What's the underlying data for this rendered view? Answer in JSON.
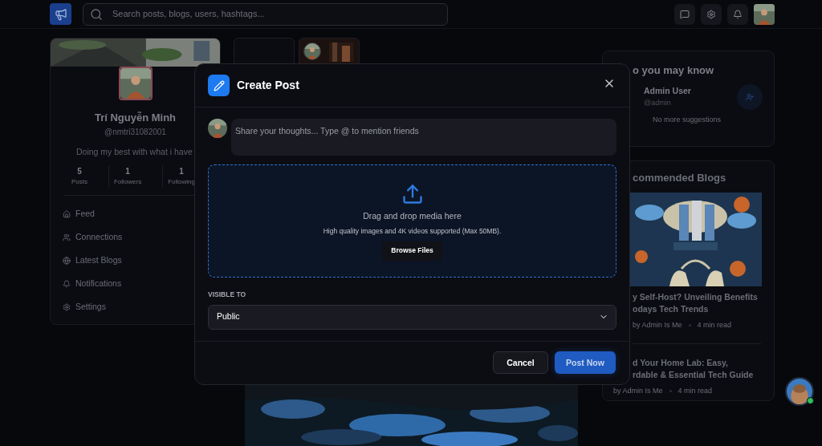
{
  "header": {
    "search": {
      "placeholder": "Search posts, blogs, users, hashtags..."
    },
    "actions": [
      {
        "kind": "messages"
      },
      {
        "kind": "settings"
      },
      {
        "kind": "notifications"
      }
    ]
  },
  "profile": {
    "name": "Trí Nguyễn Minh",
    "handle": "@nmtri31082001",
    "bio": "Doing my best with what i have",
    "stats": [
      {
        "value": "5",
        "label": "Posts"
      },
      {
        "value": "1",
        "label": "Followers"
      },
      {
        "value": "1",
        "label": "Following"
      }
    ]
  },
  "nav": [
    {
      "label": "Feed",
      "kind": "home"
    },
    {
      "label": "Connections",
      "kind": "people"
    },
    {
      "label": "Latest Blogs",
      "kind": "globe"
    },
    {
      "label": "Notifications",
      "kind": "bell"
    },
    {
      "label": "Settings",
      "kind": "gear"
    }
  ],
  "modal": {
    "title": "Create Post",
    "composer": {
      "placeholder": "Share your thoughts... Type @ to mention friends"
    },
    "dropzone": {
      "title": "Drag and drop media here",
      "hint": "High quality images and 4K videos supported (Max 50MB).",
      "button": "Browse Files"
    },
    "visibility": {
      "label": "VISIBLE TO",
      "value": "Public"
    },
    "buttons": [
      {
        "label": "Cancel",
        "kind": "secondary"
      },
      {
        "label": "Post Now",
        "kind": "primary"
      }
    ]
  },
  "suggestions": {
    "title": "o you may know",
    "people": [
      {
        "name": "Admin User",
        "handle": "@admin"
      }
    ],
    "note": "No more suggestions"
  },
  "blogs": {
    "title": "commended Blogs",
    "items": [
      {
        "kind": "featured",
        "title_lines": [
          "y Self-Host? Unveiling Benefits",
          "odays Tech Trends"
        ],
        "author": "by Admin Is Me",
        "read_time": "4 min read"
      },
      {
        "kind": "compact",
        "title_lines": [
          "d Your Home Lab: Easy,",
          "rdable & Essential Tech Guide"
        ],
        "author": "by Admin Is Me",
        "read_time": "4 min read"
      }
    ]
  },
  "chat": {
    "online": true
  }
}
